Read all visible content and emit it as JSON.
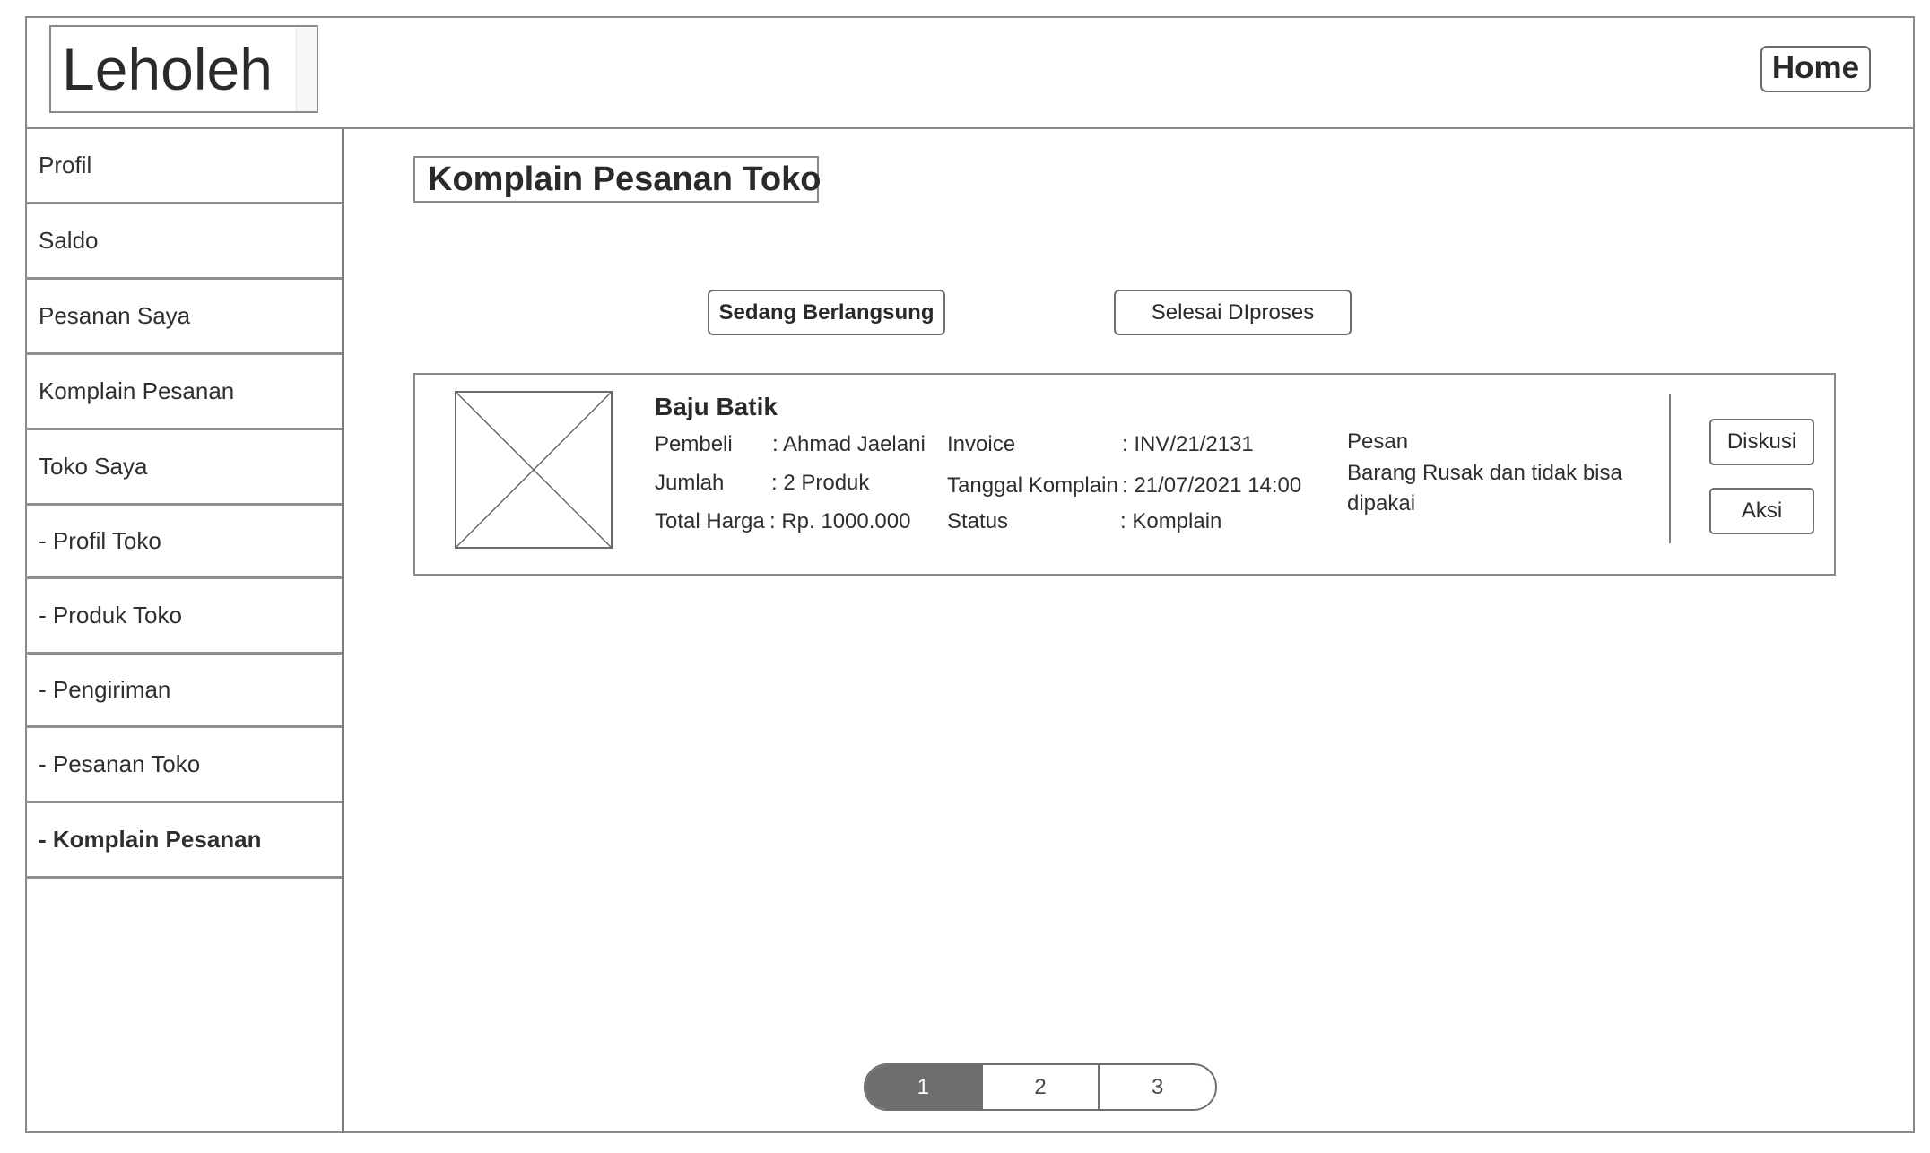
{
  "header": {
    "logo": "Leholeh",
    "home_label": "Home"
  },
  "sidebar": {
    "items": [
      {
        "label": "Profil"
      },
      {
        "label": "Saldo"
      },
      {
        "label": "Pesanan Saya"
      },
      {
        "label": "Komplain Pesanan"
      },
      {
        "label": "Toko Saya"
      },
      {
        "label": "- Profil Toko"
      },
      {
        "label": "- Produk Toko"
      },
      {
        "label": "- Pengiriman"
      },
      {
        "label": "- Pesanan Toko"
      },
      {
        "label": "- Komplain Pesanan",
        "active": true
      }
    ]
  },
  "main": {
    "title": "Komplain Pesanan Toko",
    "tabs": [
      {
        "label": "Sedang Berlangsung",
        "active": true
      },
      {
        "label": "Selesai DIproses",
        "active": false
      }
    ],
    "complaint": {
      "product_name": "Baju Batik",
      "buyer_label": "Pembeli",
      "buyer_value": ": Ahmad Jaelani",
      "quantity_label": "Jumlah",
      "quantity_value": ": 2 Produk",
      "total_label": "Total Harga",
      "total_value": ": Rp. 1000.000",
      "invoice_label": "Invoice",
      "invoice_value": ": INV/21/2131",
      "date_label": "Tanggal Komplain",
      "date_value": ": 21/07/2021 14:00",
      "status_label": "Status",
      "status_value": ": Komplain",
      "message_label": "Pesan",
      "message_line1": "Barang Rusak dan tidak bisa",
      "message_line2": "dipakai",
      "discuss_label": "Diskusi",
      "action_label": "Aksi"
    },
    "pagination": {
      "pages": [
        "1",
        "2",
        "3"
      ],
      "current": "1"
    }
  }
}
